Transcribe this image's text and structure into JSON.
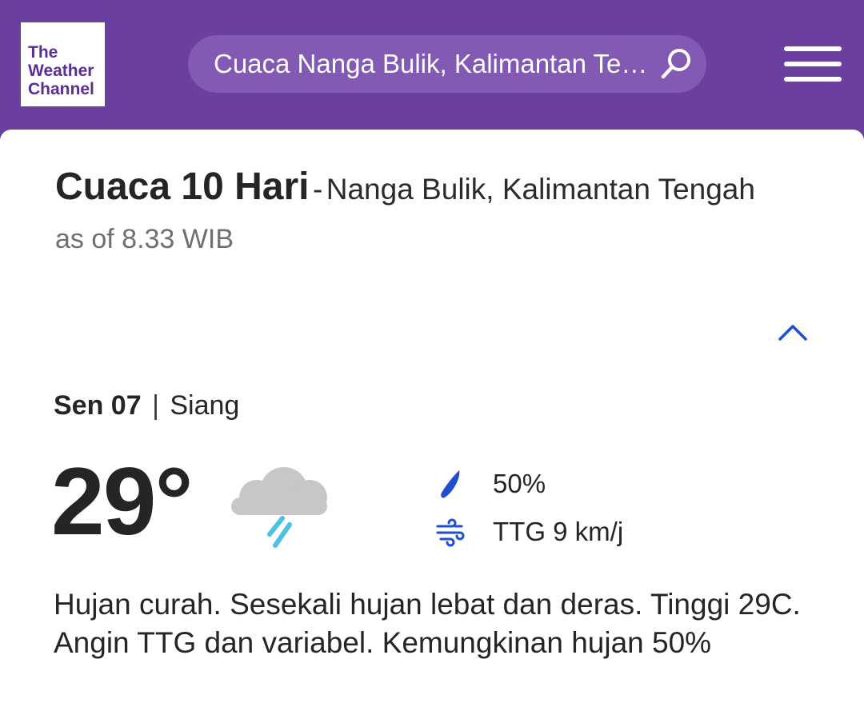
{
  "header": {
    "logo": {
      "line1": "The",
      "line2": "Weather",
      "line3": "Channel"
    },
    "search": {
      "text": "Cuaca Nanga Bulik, Kalimantan Tengah"
    },
    "colors": {
      "brand": "#6b3fa0",
      "search_bg": "#8259b3"
    },
    "icons": {
      "search": "search-icon",
      "menu": "menu-icon"
    }
  },
  "page": {
    "title": "Cuaca 10 Hari",
    "title_separator": "-",
    "location": "Nanga Bulik, Kalimantan Tengah",
    "as_of": "as of 8.33 WIB",
    "collapse_icon": "chevron-up-icon"
  },
  "forecast": {
    "day": "Sen 07",
    "divider": "|",
    "period": "Siang",
    "temperature": "29°",
    "condition_icon": "rain-cloud-icon",
    "precip": "50%",
    "wind": "TTG 9 km/j",
    "narrative": "Hujan curah. Sesekali hujan lebat dan deras. Tinggi 29C. Angin TTG dan variabel. Kemungkinan hujan 50%",
    "colors": {
      "accent": "#1f4fcf",
      "rain": "#4cc1e3",
      "cloud": "#c7c7c7"
    }
  }
}
